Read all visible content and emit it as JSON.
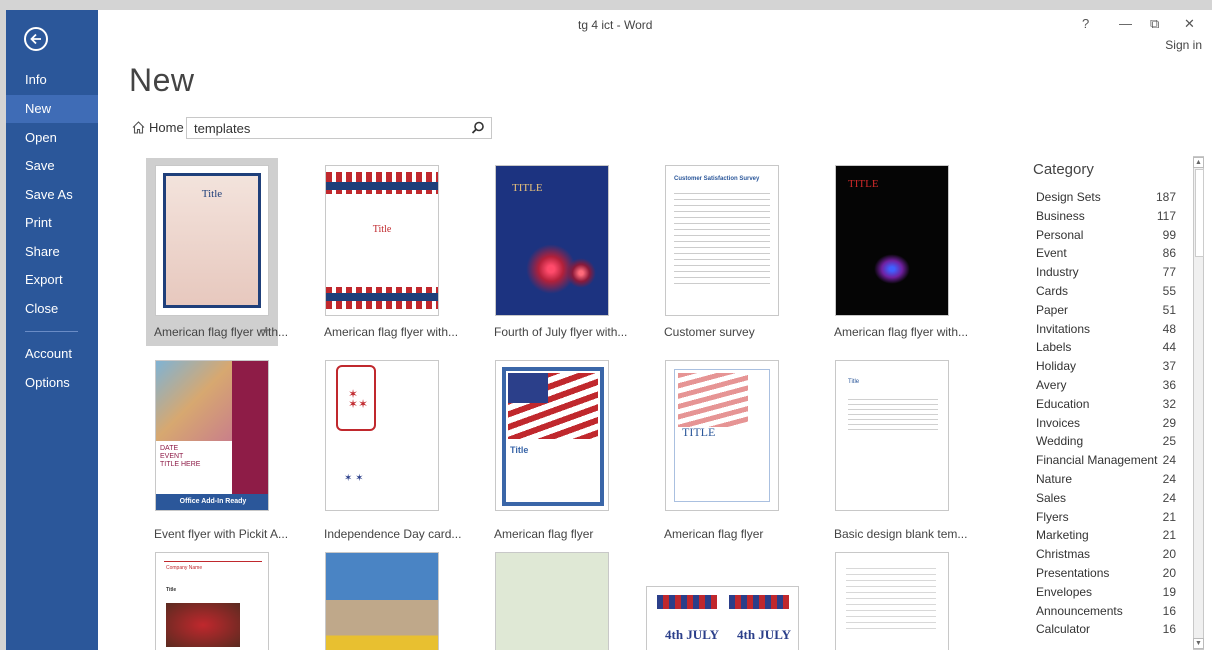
{
  "window": {
    "title": "tg 4 ict - Word",
    "signin": "Sign in",
    "help": "?",
    "minimize": "—",
    "restore": "⧉",
    "close": "✕"
  },
  "nav": {
    "items": [
      {
        "label": "Info"
      },
      {
        "label": "New"
      },
      {
        "label": "Open"
      },
      {
        "label": "Save"
      },
      {
        "label": "Save As"
      },
      {
        "label": "Print"
      },
      {
        "label": "Share"
      },
      {
        "label": "Export"
      },
      {
        "label": "Close"
      },
      {
        "label": "Account"
      },
      {
        "label": "Options"
      }
    ],
    "active": "New"
  },
  "page": {
    "title": "New",
    "home_label": "Home",
    "search_value": "templates"
  },
  "templates": [
    {
      "label": "American flag flyer with..."
    },
    {
      "label": "American flag flyer with..."
    },
    {
      "label": "Fourth of July flyer with..."
    },
    {
      "label": "Customer survey"
    },
    {
      "label": "American flag flyer with..."
    },
    {
      "label": "Event flyer with Pickit A..."
    },
    {
      "label": "Independence Day card..."
    },
    {
      "label": "American flag flyer"
    },
    {
      "label": "American flag flyer"
    },
    {
      "label": "Basic design blank tem..."
    }
  ],
  "thumb_text": {
    "title": "Title",
    "title_caps": "TITLE",
    "survey_title": "Customer Satisfaction Survey",
    "event_date": "DATE",
    "event_name": "EVENT",
    "event_title": "TITLE HERE",
    "addin_badge": "Office Add-In Ready",
    "company_name": "Company Name",
    "july": "4th JULY"
  },
  "category": {
    "header": "Category",
    "items": [
      {
        "name": "Design Sets",
        "count": "187"
      },
      {
        "name": "Business",
        "count": "117"
      },
      {
        "name": "Personal",
        "count": "99"
      },
      {
        "name": "Event",
        "count": "86"
      },
      {
        "name": "Industry",
        "count": "77"
      },
      {
        "name": "Cards",
        "count": "55"
      },
      {
        "name": "Paper",
        "count": "51"
      },
      {
        "name": "Invitations",
        "count": "48"
      },
      {
        "name": "Labels",
        "count": "44"
      },
      {
        "name": "Holiday",
        "count": "37"
      },
      {
        "name": "Avery",
        "count": "36"
      },
      {
        "name": "Education",
        "count": "32"
      },
      {
        "name": "Invoices",
        "count": "29"
      },
      {
        "name": "Wedding",
        "count": "25"
      },
      {
        "name": "Financial Management",
        "count": "24"
      },
      {
        "name": "Nature",
        "count": "24"
      },
      {
        "name": "Sales",
        "count": "24"
      },
      {
        "name": "Flyers",
        "count": "21"
      },
      {
        "name": "Marketing",
        "count": "21"
      },
      {
        "name": "Christmas",
        "count": "20"
      },
      {
        "name": "Presentations",
        "count": "20"
      },
      {
        "name": "Envelopes",
        "count": "19"
      },
      {
        "name": "Announcements",
        "count": "16"
      },
      {
        "name": "Calculator",
        "count": "16"
      }
    ]
  },
  "colors": {
    "accent": "#2b579a",
    "accent_active": "#3f6cb6"
  }
}
